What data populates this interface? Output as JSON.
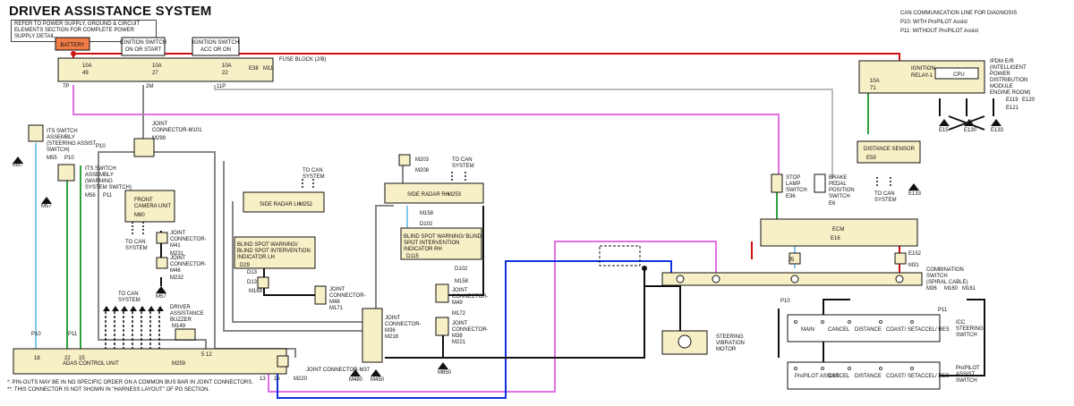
{
  "title": "DRIVER ASSISTANCE SYSTEM",
  "note": "REFER TO POWER SUPPLY, GROUND & CIRCUIT ELEMENTS SECTION FOR COMPLETE POWER SUPPLY DETAIL.",
  "legend": {
    "can": "CAN COMMUNICATION LINE FOR DIAGNOSIS",
    "p10_code": "P10",
    "p10": "WITH ProPILOT Assist",
    "p11_code": "P11",
    "p11": "WITHOUT ProPILOT Assist"
  },
  "footnotes": [
    "*: PIN-OUTS MAY BE IN NO SPECIFIC ORDER ON A COMMON BUS BAR IN JOINT CONNECTORS.",
    "**: THIS CONNECTOR IS NOT SHOWN IN \"HARNESS LAYOUT\" OF PG SECTION."
  ],
  "power": {
    "battery": "BATTERY",
    "ign1": [
      "IGNITION SWITCH",
      "ON OR START"
    ],
    "ign2": [
      "IGNITION SWITCH",
      "ACC OR ON"
    ]
  },
  "fuse_block": {
    "label": "FUSE BLOCK (J/B)",
    "codes": [
      "E38",
      "M11"
    ],
    "fuses": [
      {
        "amp": "10A",
        "num": "49",
        "pin": "7P"
      },
      {
        "amp": "10A",
        "num": "27",
        "pin": "2M"
      },
      {
        "amp": "10A",
        "num": "22",
        "pin": "11P"
      }
    ]
  },
  "ipdm": {
    "label": [
      "IPDM E/R",
      "(INTELLIGENT",
      "POWER",
      "DISTRIBUTION",
      "MODULE",
      "ENGINE ROOM)"
    ],
    "codes": [
      "E119",
      "E120",
      "E121"
    ],
    "fuse": "10A",
    "fuse_num": "71",
    "relay": [
      "IGNITION",
      "RELAY-1"
    ],
    "cpu": "CPU",
    "pins": [
      "11",
      "47",
      "12",
      "11"
    ],
    "grounds": [
      "E15",
      "E130",
      "E133"
    ]
  },
  "components": {
    "its_sw1": [
      "ITS SWITCH",
      "ASSEMBLY",
      "(STEERING ASSIST",
      "SWITCH)"
    ],
    "its_sw1_codes": [
      "M55",
      "P10"
    ],
    "its_sw2": [
      "ITS SWITCH",
      "ASSEMBLY",
      "(WARNING",
      "SYSTEM SWITCH)"
    ],
    "its_sw2_codes": [
      "M56",
      "P11"
    ],
    "jc101": [
      "JOINT",
      "CONNECTOR-M101"
    ],
    "jc101_code": "M299",
    "front_cam": [
      "FRONT",
      "CAMERA UNIT"
    ],
    "front_cam_code": "M80",
    "jc41": [
      "JOINT",
      "CONNECTOR-",
      "M41"
    ],
    "jc41_code": "M231",
    "jc46": [
      "JOINT",
      "CONNECTOR-",
      "M46"
    ],
    "jc46_code": "M232",
    "radar_lh": "SIDE RADAR LH",
    "radar_lh_code": "M252",
    "bsw_lh": [
      "BLIND SPOT WARNING/",
      "BLIND SPOT INTERVENTION",
      "INDICATOR LH"
    ],
    "bsw_lh_code": "D29",
    "radar_rh": "SIDE RADAR RH",
    "radar_rh_code": "M253",
    "bsw_rh": [
      "BLIND SPOT WARNING/ BLIND",
      "SPOT INTERVENTION",
      "INDICATOR RH"
    ],
    "bsw_rh_code": "D115",
    "jc48": [
      "JOINT",
      "CONNECTOR-",
      "M48"
    ],
    "jc48_code": "M171",
    "jc36": [
      "JOINT",
      "CONNECTOR-",
      "M36"
    ],
    "jc36_code": "M218",
    "jc49": [
      "JOINT",
      "CONNECTOR-",
      "M49"
    ],
    "jc49_code": "M172",
    "jc38": [
      "JOINT",
      "CONNECTOR-",
      "M38"
    ],
    "jc38_code": "M221",
    "jc37": "JOINT CONNECTOR-M37",
    "jc37_code": "M220",
    "buzzer": [
      "DRIVER",
      "ASSISTANCE",
      "BUZZER"
    ],
    "buzzer_code": "M149",
    "adas": "ADAS CONTROL UNIT",
    "adas_code": "M259",
    "stop_lamp": [
      "STOP",
      "LAMP",
      "SWITCH"
    ],
    "stop_lamp_code": "E36",
    "brake": [
      "BRAKE",
      "PEDAL",
      "POSITION",
      "SWITCH"
    ],
    "brake_code": "E6",
    "dist": "DISTANCE SENSOR",
    "dist_code": "E59",
    "ecm": "ECM",
    "ecm_code": "E16",
    "combi": [
      "COMBINATION",
      "SWITCH",
      "(SPIRAL CABLE)"
    ],
    "combi_codes": [
      "M36",
      "M160",
      "M161"
    ],
    "combi_extra": [
      "E152",
      "M31"
    ],
    "motor": [
      "STEERING",
      "VIBRATION",
      "MOTOR"
    ],
    "icc": [
      "ICC",
      "STEERING",
      "SWITCH"
    ],
    "propilot": [
      "ProPILOT",
      "ASSIST",
      "SWITCH"
    ],
    "icc_buttons": [
      "MAIN",
      "CANCEL",
      "DISTANCE",
      "COAST/ SET",
      "ACCEL/ RES"
    ],
    "pp_buttons": [
      "ProPILOT ASSIST",
      "CANCEL",
      "DISTANCE",
      "COAST/ SET",
      "ACCEL/ RES"
    ]
  },
  "text": {
    "to_can": [
      "TO CAN",
      "SYSTEM"
    ]
  },
  "grounds": [
    "M57",
    "M57",
    "M57",
    "M480",
    "M450",
    "M850",
    "E133"
  ],
  "pins_adas": [
    "18",
    "22",
    "15",
    "5",
    "12",
    "13",
    "16",
    "7"
  ],
  "connectors": [
    "D13",
    "D13",
    "M169",
    "M158",
    "M158",
    "D102",
    "D102",
    "M203",
    "M208",
    "P10",
    "P11",
    "P10",
    "P11",
    "J5",
    "J5"
  ],
  "colors": {
    "red": "#d01010",
    "pink": "#e070e0",
    "blue": "#1030e0",
    "lightblue": "#80c8e8",
    "green": "#30a040",
    "gray": "#888888",
    "black": "#111111",
    "lightgreen": "#80e090",
    "tan": "#f7efc6",
    "orange": "#ef7b45"
  }
}
